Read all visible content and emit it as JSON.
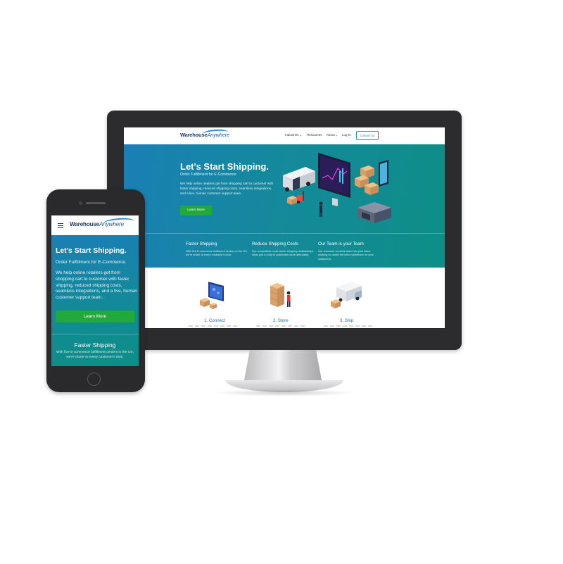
{
  "brand": {
    "name_bold": "Warehouse",
    "name_italic": "Anywhere"
  },
  "desktop": {
    "nav": {
      "items": [
        {
          "label": "Industries",
          "has_dropdown": true
        },
        {
          "label": "Resources",
          "has_dropdown": false
        },
        {
          "label": "About",
          "has_dropdown": true
        },
        {
          "label": "Log In",
          "has_dropdown": false
        }
      ],
      "contact_label": "Contact Us"
    },
    "hero": {
      "title": "Let's Start Shipping.",
      "subtitle": "Order Fulfillment for E-Commerce.",
      "body": "We help online retailers get from shopping cart to customer with faster shipping, reduced shipping costs, seamless integrations, and a live, human customer support team.",
      "cta_label": "Learn More"
    },
    "features": [
      {
        "title": "Faster Shipping",
        "body": "With five E-commerce fulfillment centers in the US, we're closer to every customer's door."
      },
      {
        "title": "Reduce Shipping Costs",
        "body": "Our competitive multi-carrier shipping relationships allow you to ship to customers more affordably."
      },
      {
        "title": "Our Team is your Team",
        "body": "Our customer success team has your back, working to create the best experience for your customers."
      }
    ],
    "steps": [
      {
        "label": "1. Connect",
        "icon": "computer-boxes-icon"
      },
      {
        "label": "2. Store",
        "icon": "warehouse-worker-icon"
      },
      {
        "label": "3 .Ship",
        "icon": "delivery-truck-icon"
      }
    ]
  },
  "mobile": {
    "hero": {
      "title": "Let's Start Shipping.",
      "subtitle": "Order Fulfillment for E-Commerce.",
      "body": "We help online retailers get from shopping cart to customer with faster shipping, reduced shipping costs, seamless integrations, and a live, human customer support team.",
      "cta_label": "Learn More"
    },
    "feature": {
      "title": "Faster Shipping",
      "body": "With five E-commerce fulfillment centers in the US, we're closer to every customer's door."
    }
  },
  "colors": {
    "brand_navy": "#1e3a6e",
    "brand_blue": "#1d5fb0",
    "hero_gradient_start": "#1a7fb5",
    "hero_gradient_end": "#0d8e86",
    "cta_green": "#22a93c",
    "device_frame": "#2c2c2e"
  }
}
